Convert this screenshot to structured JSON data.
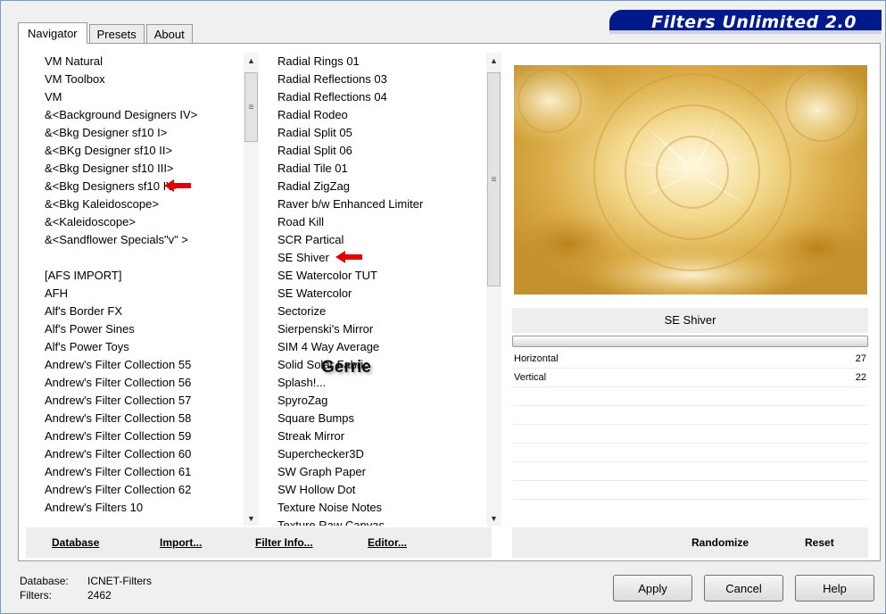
{
  "app_title": "Filters Unlimited 2.0",
  "tabs": [
    {
      "label": "Navigator"
    },
    {
      "label": "Presets"
    },
    {
      "label": "About"
    }
  ],
  "categories": [
    "VM Natural",
    "VM Toolbox",
    "VM",
    "&<Background Designers IV>",
    "&<Bkg Designer sf10 I>",
    "&<BKg Designer sf10 II>",
    "&<Bkg Designer sf10 III>",
    "&<Bkg Designers sf10 IV>",
    "&<Bkg Kaleidoscope>",
    "&<Kaleidoscope>",
    "&<Sandflower Specials\"v\" >",
    "",
    "[AFS IMPORT]",
    "AFH",
    "Alf's Border FX",
    "Alf's Power Sines",
    "Alf's Power Toys",
    "Andrew's Filter Collection 55",
    "Andrew's Filter Collection 56",
    "Andrew's Filter Collection 57",
    "Andrew's Filter Collection 58",
    "Andrew's Filter Collection 59",
    "Andrew's Filter Collection 60",
    "Andrew's Filter Collection 61",
    "Andrew's Filter Collection 62",
    "Andrew's Filters 10"
  ],
  "filters": [
    "Radial  Rings 01",
    "Radial Reflections 03",
    "Radial Reflections 04",
    "Radial Rodeo",
    "Radial Split 05",
    "Radial Split 06",
    "Radial Tile 01",
    "Radial ZigZag",
    "Raver b/w Enhanced Limiter",
    "Road Kill",
    "SCR  Partical",
    "SE Shiver",
    "SE Watercolor TUT",
    "SE Watercolor",
    "Sectorize",
    "Sierpenski's Mirror",
    "SIM 4 Way Average",
    "Solid Solar Fabric",
    "Splash!...",
    "SpyroZag",
    "Square Bumps",
    "Streak Mirror",
    "Superchecker3D",
    "SW Graph Paper",
    "SW Hollow Dot",
    "Texture Noise Notes",
    "Texture Raw Canvas"
  ],
  "watermark": "Gerrie",
  "left_buttons": {
    "database": "Database",
    "import": "Import...",
    "filter_info": "Filter Info...",
    "editor": "Editor..."
  },
  "selected_filter_name": "SE Shiver",
  "params": [
    {
      "label": "Horizontal",
      "value": "27"
    },
    {
      "label": "Vertical",
      "value": "22"
    }
  ],
  "right_buttons": {
    "randomize": "Randomize",
    "reset": "Reset"
  },
  "footer": {
    "database_label": "Database:",
    "database_value": "ICNET-Filters",
    "filters_label": "Filters:",
    "filters_value": "2462"
  },
  "dialog_buttons": {
    "apply": "Apply",
    "cancel": "Cancel",
    "help": "Help"
  },
  "colors": {
    "banner": "#001a8c",
    "arrow": "#e00000",
    "preview_gold": "#d8a840"
  }
}
